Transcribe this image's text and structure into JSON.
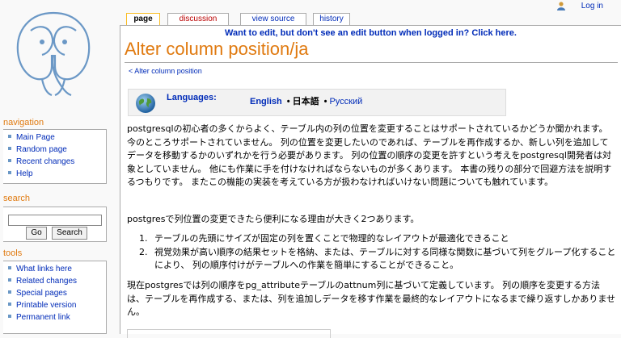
{
  "header": {
    "login": "Log in",
    "tabs": [
      "page",
      "discussion",
      "view source",
      "history"
    ]
  },
  "notice": "Want to edit, but don't see an edit button when logged in? Click here.",
  "page": {
    "title": "Alter column position/ja",
    "subpage": "< Alter column position"
  },
  "languages": {
    "label": "Languages:",
    "items": [
      "English",
      "日本語",
      "Русский"
    ]
  },
  "content": {
    "p1": "postgresqlの初心者の多くからよく、テーブル内の列の位置を変更することはサポートされているかどうか聞かれます。 今のところサポートされていません。 列の位置を変更したいのであれば、テーブルを再作成するか、新しい列を追加してデータを移動するかのいずれかを行う必要があります。 列の位置の順序の変更を許すという考えをpostgresql開発者は対象としていません。 他にも作業に手を付けなければならないものが多くあります。 本書の残りの部分で回避方法を説明するつもりです。 またこの機能の実装を考えている方が扱わなければいけない問題についても触れています。",
    "p2": "postgresで列位置の変更できたら便利になる理由が大きく2つあります。",
    "list": [
      "テーブルの先頭にサイズが固定の列を置くことで物理的なレイアウトが最適化できること",
      "視覚効果が高い順序の結果セットを格納、または、テーブルに対する同様な関数に基づいて列をグループ化することにより、 列の順序付けがテーブルへの作業を簡単にすることができること。"
    ],
    "p3": "現在postgresでは列の順序をpg_attributeテーブルのattnum列に基づいて定義しています。 列の順序を変更する方法は、テーブルを再作成する、または、列を追加しデータを移す作業を最終的なレイアウトになるまで繰り返すしかありません。"
  },
  "sidebar": {
    "navigation": {
      "title": "navigation",
      "items": [
        "Main Page",
        "Random page",
        "Recent changes",
        "Help"
      ]
    },
    "search": {
      "title": "search",
      "go": "Go",
      "search": "Search"
    },
    "tools": {
      "title": "tools",
      "items": [
        "What links here",
        "Related changes",
        "Special pages",
        "Printable version",
        "Permanent link"
      ]
    }
  },
  "colors": {
    "accent": "#e07a10",
    "link": "#002bb8",
    "redlink": "#ba0000"
  }
}
